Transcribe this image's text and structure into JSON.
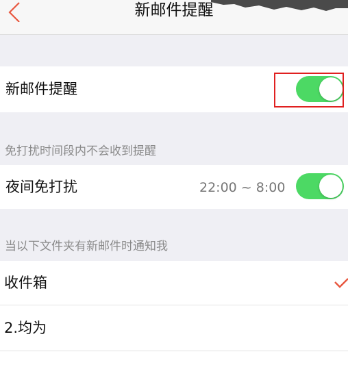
{
  "header": {
    "title": "新邮件提醒",
    "back_icon": "chevron-left-icon"
  },
  "new_mail_alert": {
    "label": "新邮件提醒",
    "enabled": true
  },
  "quiet_hours": {
    "section_label": "免打扰时间段内不会收到提醒",
    "label": "夜间免打扰",
    "time_range": "22:00 ~ 8:00",
    "enabled": true
  },
  "folders": {
    "section_label": "当以下文件夹有新邮件时通知我",
    "items": [
      {
        "label": "收件箱",
        "checked": true
      },
      {
        "label": "2.均为",
        "checked": false
      }
    ]
  },
  "colors": {
    "accent": "#e8573f",
    "toggle_on": "#4cd964",
    "highlight": "#e02020"
  }
}
